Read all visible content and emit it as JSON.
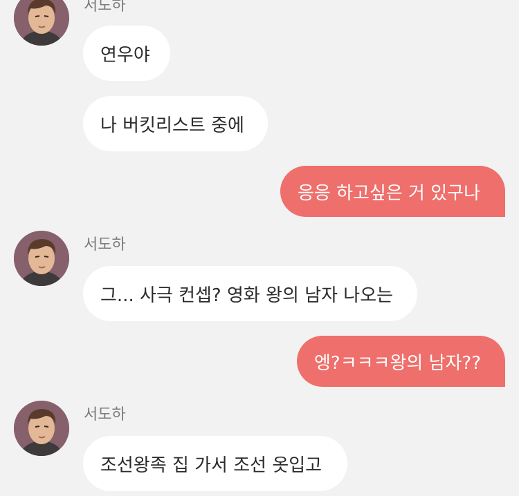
{
  "colors": {
    "background": "#f2f2f2",
    "incoming_bubble": "#ffffff",
    "outgoing_bubble": "#ee6f6b",
    "sender_name": "#7b7b7b"
  },
  "messages": [
    {
      "type": "sender",
      "name": "서도하"
    },
    {
      "type": "in",
      "text": "연우야"
    },
    {
      "type": "in",
      "text": "나 버킷리스트 중에"
    },
    {
      "type": "out",
      "text": "응응 하고싶은 거 있구나"
    },
    {
      "type": "sender",
      "name": "서도하"
    },
    {
      "type": "in",
      "text": "그... 사극 컨셉? 영화 왕의 남자 나오는"
    },
    {
      "type": "out",
      "text": "엥?ㅋㅋㅋ왕의 남자??"
    },
    {
      "type": "sender",
      "name": "서도하"
    },
    {
      "type": "in",
      "text": "조선왕족 집 가서 조선 옷입고"
    }
  ]
}
